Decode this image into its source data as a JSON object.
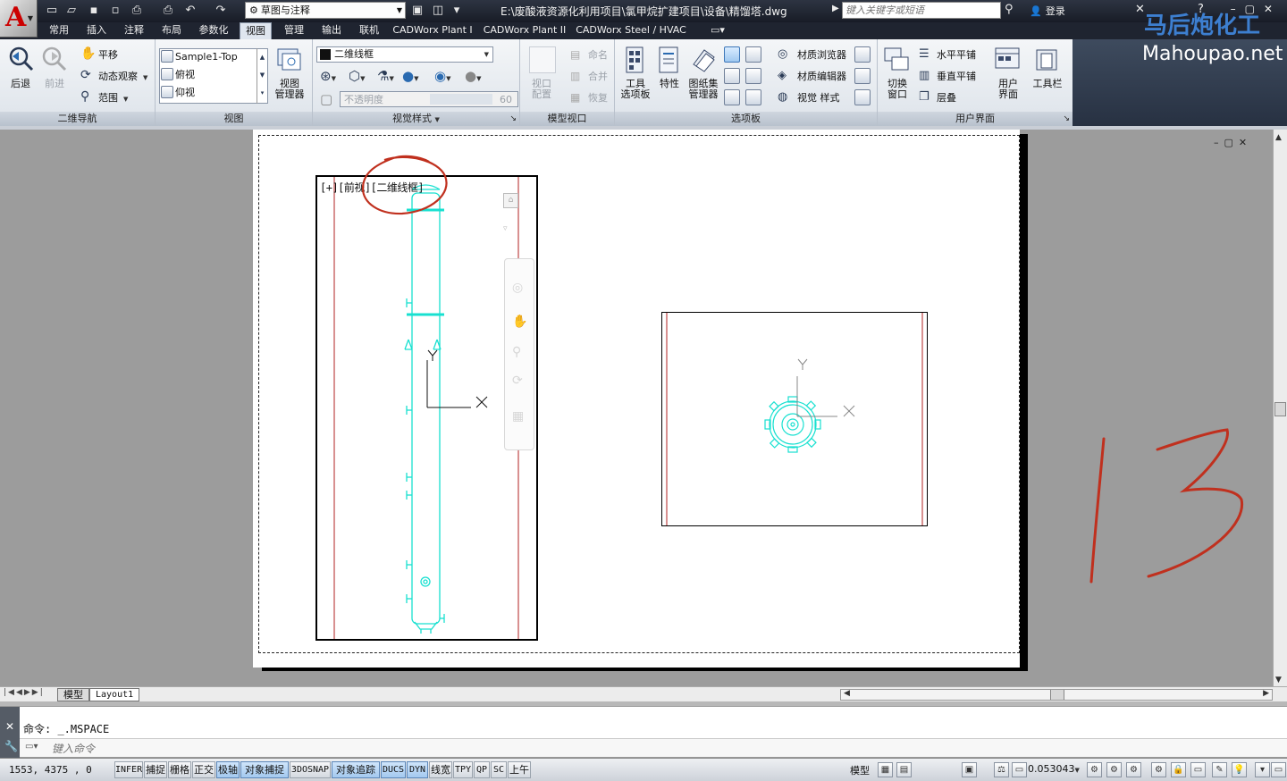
{
  "titlebar": {
    "workspace": "草图与注释",
    "document_title": "E:\\废酸液资源化利用项目\\氯甲烷扩建项目\\设备\\精馏塔.dwg",
    "search_placeholder": "键入关键字或短语",
    "login_label": "登录"
  },
  "tabs": [
    "常用",
    "插入",
    "注释",
    "布局",
    "参数化",
    "视图",
    "管理",
    "输出",
    "联机",
    "CADWorx Plant I",
    "CADWorx Plant II",
    "CADWorx Steel / HVAC"
  ],
  "active_tab": "视图",
  "ribbon": {
    "nav2d": {
      "title": "二维导航",
      "back": "后退",
      "forward": "前进",
      "pan": "平移",
      "orbit": "动态观察",
      "extents": "范围"
    },
    "views": {
      "title": "视图",
      "items": [
        "Sample1-Top",
        "俯视",
        "仰视"
      ],
      "manager": "视图\n管理器"
    },
    "visual_styles": {
      "title": "视觉样式",
      "current": "二维线框",
      "opacity_label": "不透明度",
      "opacity_value": "60"
    },
    "model_viewports": {
      "title": "模型视口",
      "config": "视口\n配置",
      "name": "命名",
      "join": "合并",
      "restore": "恢复"
    },
    "palettes": {
      "title": "选项板",
      "tool_palettes": "工具\n选项板",
      "properties": "特性",
      "sheet_set": "图纸集\n管理器",
      "material_browser": "材质浏览器",
      "material_editor": "材质编辑器",
      "visual_styles_mgr": "视觉 样式"
    },
    "ui": {
      "title": "用户界面",
      "switch_window": "切换\n窗口",
      "tile_h": "水平平铺",
      "tile_v": "垂直平铺",
      "cascade": "层叠",
      "user_interface": "用户\n界面",
      "toolbars": "工具栏"
    }
  },
  "watermark": {
    "brand": "马后炮化工",
    "url": "Mahoupao.net"
  },
  "viewport_left": {
    "label": "[+][前视][二维线框]"
  },
  "ucs": {
    "x": "X",
    "y": "Y"
  },
  "annotation_number": "13",
  "layout_tabs": [
    "模型",
    "Layout1"
  ],
  "active_layout": "Layout1",
  "command": {
    "history": "命令: _.MSPACE",
    "placeholder": "键入命令"
  },
  "status": {
    "coords": "1553,  4375 , 0",
    "toggles": [
      {
        "label": "INFER",
        "on": false,
        "mono": true
      },
      {
        "label": "捕捉",
        "on": false
      },
      {
        "label": "栅格",
        "on": false
      },
      {
        "label": "正交",
        "on": false
      },
      {
        "label": "极轴",
        "on": true
      },
      {
        "label": "对象捕捉",
        "on": true
      },
      {
        "label": "3DOSNAP",
        "on": false,
        "mono": true
      },
      {
        "label": "对象追踪",
        "on": true
      },
      {
        "label": "DUCS",
        "on": true,
        "mono": true
      },
      {
        "label": "DYN",
        "on": true,
        "mono": true
      },
      {
        "label": "线宽",
        "on": false
      },
      {
        "label": "TPY",
        "on": false,
        "mono": true
      },
      {
        "label": "QP",
        "on": false,
        "mono": true
      },
      {
        "label": "SC",
        "on": false,
        "mono": true
      },
      {
        "label": "上午",
        "on": false
      }
    ],
    "space": "模型",
    "scale": "0.053043"
  },
  "colors": {
    "accent_cyan": "#18e0d0",
    "annotation_red": "#c0301e",
    "viewport_red_line": "#b02020"
  }
}
